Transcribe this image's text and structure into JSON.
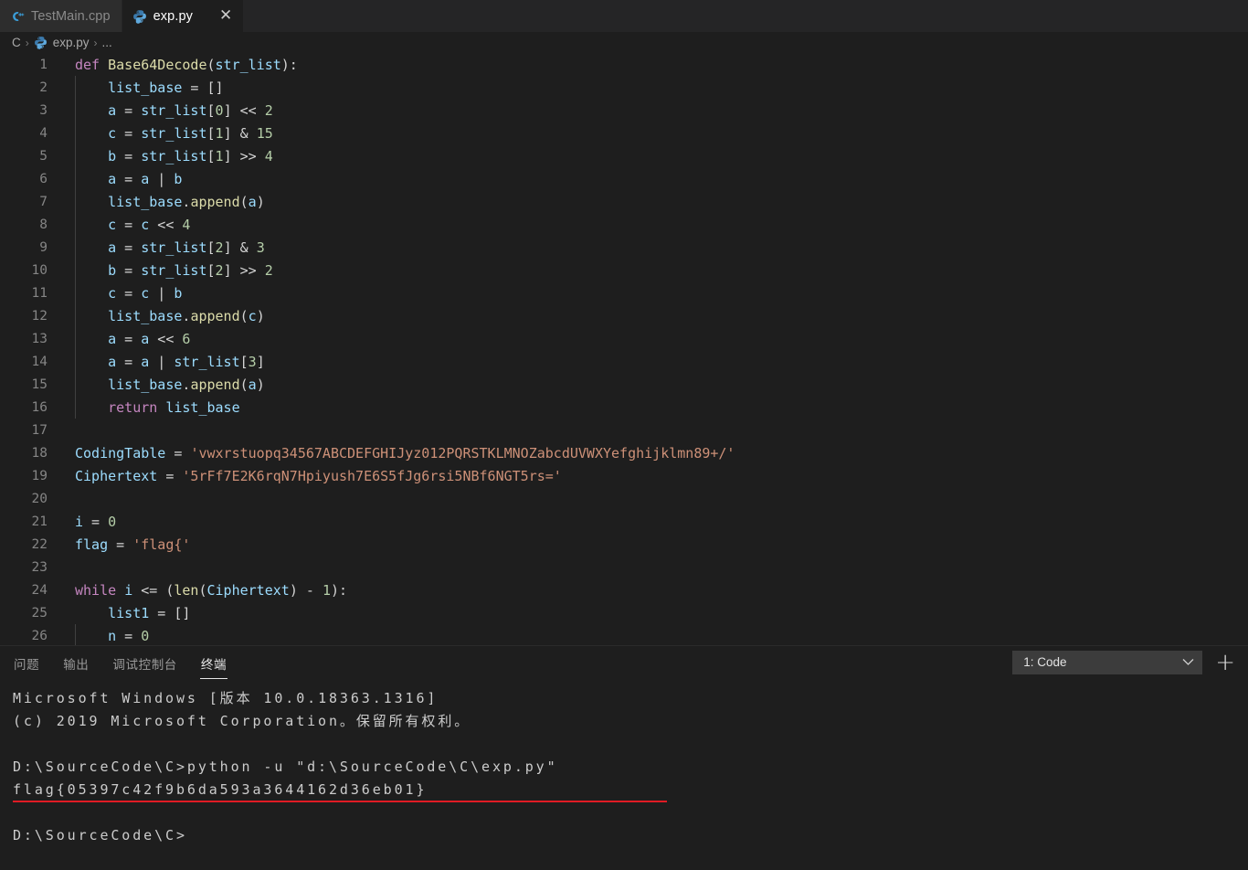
{
  "tabs": [
    {
      "label": "TestMain.cpp",
      "icon": "cpp-file-icon",
      "active": false,
      "closable": false
    },
    {
      "label": "exp.py",
      "icon": "python-file-icon",
      "active": true,
      "closable": true,
      "close_label": "✕"
    }
  ],
  "breadcrumb": {
    "root": "C",
    "separator": "›",
    "file": "exp.py",
    "tail": "..."
  },
  "editor": {
    "language": "python",
    "lines": [
      {
        "n": "1",
        "indent": 0,
        "tokens": [
          {
            "t": "def ",
            "c": "t-kw"
          },
          {
            "t": "Base64Decode",
            "c": "t-fn"
          },
          {
            "t": "(",
            "c": "t-punc"
          },
          {
            "t": "str_list",
            "c": "t-var"
          },
          {
            "t": "):",
            "c": "t-punc"
          }
        ]
      },
      {
        "n": "2",
        "indent": 1,
        "tokens": [
          {
            "t": "list_base",
            "c": "t-var"
          },
          {
            "t": " = ",
            "c": "t-op"
          },
          {
            "t": "[]",
            "c": "t-punc"
          }
        ]
      },
      {
        "n": "3",
        "indent": 1,
        "tokens": [
          {
            "t": "a",
            "c": "t-var"
          },
          {
            "t": " = ",
            "c": "t-op"
          },
          {
            "t": "str_list",
            "c": "t-var"
          },
          {
            "t": "[",
            "c": "t-punc"
          },
          {
            "t": "0",
            "c": "t-num"
          },
          {
            "t": "] ",
            "c": "t-punc"
          },
          {
            "t": "<< ",
            "c": "t-op"
          },
          {
            "t": "2",
            "c": "t-num"
          }
        ]
      },
      {
        "n": "4",
        "indent": 1,
        "tokens": [
          {
            "t": "c",
            "c": "t-var"
          },
          {
            "t": " = ",
            "c": "t-op"
          },
          {
            "t": "str_list",
            "c": "t-var"
          },
          {
            "t": "[",
            "c": "t-punc"
          },
          {
            "t": "1",
            "c": "t-num"
          },
          {
            "t": "] ",
            "c": "t-punc"
          },
          {
            "t": "& ",
            "c": "t-op"
          },
          {
            "t": "15",
            "c": "t-num"
          }
        ]
      },
      {
        "n": "5",
        "indent": 1,
        "tokens": [
          {
            "t": "b",
            "c": "t-var"
          },
          {
            "t": " = ",
            "c": "t-op"
          },
          {
            "t": "str_list",
            "c": "t-var"
          },
          {
            "t": "[",
            "c": "t-punc"
          },
          {
            "t": "1",
            "c": "t-num"
          },
          {
            "t": "] ",
            "c": "t-punc"
          },
          {
            "t": ">> ",
            "c": "t-op"
          },
          {
            "t": "4",
            "c": "t-num"
          }
        ]
      },
      {
        "n": "6",
        "indent": 1,
        "tokens": [
          {
            "t": "a",
            "c": "t-var"
          },
          {
            "t": " = ",
            "c": "t-op"
          },
          {
            "t": "a",
            "c": "t-var"
          },
          {
            "t": " | ",
            "c": "t-op"
          },
          {
            "t": "b",
            "c": "t-var"
          }
        ]
      },
      {
        "n": "7",
        "indent": 1,
        "tokens": [
          {
            "t": "list_base",
            "c": "t-var"
          },
          {
            "t": ".",
            "c": "t-punc"
          },
          {
            "t": "append",
            "c": "t-fn"
          },
          {
            "t": "(",
            "c": "t-punc"
          },
          {
            "t": "a",
            "c": "t-var"
          },
          {
            "t": ")",
            "c": "t-punc"
          }
        ]
      },
      {
        "n": "8",
        "indent": 1,
        "tokens": [
          {
            "t": "c",
            "c": "t-var"
          },
          {
            "t": " = ",
            "c": "t-op"
          },
          {
            "t": "c",
            "c": "t-var"
          },
          {
            "t": " << ",
            "c": "t-op"
          },
          {
            "t": "4",
            "c": "t-num"
          }
        ]
      },
      {
        "n": "9",
        "indent": 1,
        "tokens": [
          {
            "t": "a",
            "c": "t-var"
          },
          {
            "t": " = ",
            "c": "t-op"
          },
          {
            "t": "str_list",
            "c": "t-var"
          },
          {
            "t": "[",
            "c": "t-punc"
          },
          {
            "t": "2",
            "c": "t-num"
          },
          {
            "t": "] ",
            "c": "t-punc"
          },
          {
            "t": "& ",
            "c": "t-op"
          },
          {
            "t": "3",
            "c": "t-num"
          }
        ]
      },
      {
        "n": "10",
        "indent": 1,
        "tokens": [
          {
            "t": "b",
            "c": "t-var"
          },
          {
            "t": " = ",
            "c": "t-op"
          },
          {
            "t": "str_list",
            "c": "t-var"
          },
          {
            "t": "[",
            "c": "t-punc"
          },
          {
            "t": "2",
            "c": "t-num"
          },
          {
            "t": "] ",
            "c": "t-punc"
          },
          {
            "t": ">> ",
            "c": "t-op"
          },
          {
            "t": "2",
            "c": "t-num"
          }
        ]
      },
      {
        "n": "11",
        "indent": 1,
        "tokens": [
          {
            "t": "c",
            "c": "t-var"
          },
          {
            "t": " = ",
            "c": "t-op"
          },
          {
            "t": "c",
            "c": "t-var"
          },
          {
            "t": " | ",
            "c": "t-op"
          },
          {
            "t": "b",
            "c": "t-var"
          }
        ]
      },
      {
        "n": "12",
        "indent": 1,
        "tokens": [
          {
            "t": "list_base",
            "c": "t-var"
          },
          {
            "t": ".",
            "c": "t-punc"
          },
          {
            "t": "append",
            "c": "t-fn"
          },
          {
            "t": "(",
            "c": "t-punc"
          },
          {
            "t": "c",
            "c": "t-var"
          },
          {
            "t": ")",
            "c": "t-punc"
          }
        ]
      },
      {
        "n": "13",
        "indent": 1,
        "tokens": [
          {
            "t": "a",
            "c": "t-var"
          },
          {
            "t": " = ",
            "c": "t-op"
          },
          {
            "t": "a",
            "c": "t-var"
          },
          {
            "t": " << ",
            "c": "t-op"
          },
          {
            "t": "6",
            "c": "t-num"
          }
        ]
      },
      {
        "n": "14",
        "indent": 1,
        "tokens": [
          {
            "t": "a",
            "c": "t-var"
          },
          {
            "t": " = ",
            "c": "t-op"
          },
          {
            "t": "a",
            "c": "t-var"
          },
          {
            "t": " | ",
            "c": "t-op"
          },
          {
            "t": "str_list",
            "c": "t-var"
          },
          {
            "t": "[",
            "c": "t-punc"
          },
          {
            "t": "3",
            "c": "t-num"
          },
          {
            "t": "]",
            "c": "t-punc"
          }
        ]
      },
      {
        "n": "15",
        "indent": 1,
        "tokens": [
          {
            "t": "list_base",
            "c": "t-var"
          },
          {
            "t": ".",
            "c": "t-punc"
          },
          {
            "t": "append",
            "c": "t-fn"
          },
          {
            "t": "(",
            "c": "t-punc"
          },
          {
            "t": "a",
            "c": "t-var"
          },
          {
            "t": ")",
            "c": "t-punc"
          }
        ]
      },
      {
        "n": "16",
        "indent": 1,
        "tokens": [
          {
            "t": "return ",
            "c": "t-kw"
          },
          {
            "t": "list_base",
            "c": "t-var"
          }
        ]
      },
      {
        "n": "17",
        "indent": 0,
        "tokens": []
      },
      {
        "n": "18",
        "indent": 0,
        "tokens": [
          {
            "t": "CodingTable",
            "c": "t-var"
          },
          {
            "t": " = ",
            "c": "t-op"
          },
          {
            "t": "'vwxrstuopq34567ABCDEFGHIJyz012PQRSTKLMNOZabcdUVWXYefghijklmn89+/'",
            "c": "t-str"
          }
        ]
      },
      {
        "n": "19",
        "indent": 0,
        "tokens": [
          {
            "t": "Ciphertext",
            "c": "t-var"
          },
          {
            "t": " = ",
            "c": "t-op"
          },
          {
            "t": "'5rFf7E2K6rqN7Hpiyush7E6S5fJg6rsi5NBf6NGT5rs='",
            "c": "t-str"
          }
        ]
      },
      {
        "n": "20",
        "indent": 0,
        "tokens": []
      },
      {
        "n": "21",
        "indent": 0,
        "tokens": [
          {
            "t": "i",
            "c": "t-var"
          },
          {
            "t": " = ",
            "c": "t-op"
          },
          {
            "t": "0",
            "c": "t-num"
          }
        ]
      },
      {
        "n": "22",
        "indent": 0,
        "tokens": [
          {
            "t": "flag",
            "c": "t-var"
          },
          {
            "t": " = ",
            "c": "t-op"
          },
          {
            "t": "'flag{'",
            "c": "t-str"
          }
        ]
      },
      {
        "n": "23",
        "indent": 0,
        "tokens": []
      },
      {
        "n": "24",
        "indent": 0,
        "tokens": [
          {
            "t": "while ",
            "c": "t-kw"
          },
          {
            "t": "i",
            "c": "t-var"
          },
          {
            "t": " <= ",
            "c": "t-op"
          },
          {
            "t": "(",
            "c": "t-punc"
          },
          {
            "t": "len",
            "c": "t-builtin"
          },
          {
            "t": "(",
            "c": "t-punc"
          },
          {
            "t": "Ciphertext",
            "c": "t-var"
          },
          {
            "t": ") ",
            "c": "t-punc"
          },
          {
            "t": "- ",
            "c": "t-op"
          },
          {
            "t": "1",
            "c": "t-num"
          },
          {
            "t": "):",
            "c": "t-punc"
          }
        ]
      },
      {
        "n": "25",
        "indent": 1,
        "tokens": [
          {
            "t": "list1",
            "c": "t-var"
          },
          {
            "t": " = ",
            "c": "t-op"
          },
          {
            "t": "[]",
            "c": "t-punc"
          }
        ]
      },
      {
        "n": "26",
        "indent": 1,
        "tokens": [
          {
            "t": "n",
            "c": "t-var"
          },
          {
            "t": " = ",
            "c": "t-op"
          },
          {
            "t": "0",
            "c": "t-num"
          }
        ]
      }
    ]
  },
  "panel": {
    "tabs": [
      {
        "label": "问题",
        "active": false
      },
      {
        "label": "输出",
        "active": false
      },
      {
        "label": "调试控制台",
        "active": false
      },
      {
        "label": "终端",
        "active": true
      }
    ],
    "terminal_select": {
      "value": "1: Code",
      "chevron": "⌄"
    },
    "new_terminal_label": "+"
  },
  "terminal": {
    "lines": [
      {
        "text": "Microsoft Windows [版本 10.0.18363.1316]"
      },
      {
        "text": "(c) 2019 Microsoft Corporation。保留所有权利。"
      },
      {
        "text": ""
      },
      {
        "text": "D:\\SourceCode\\C>python -u \"d:\\SourceCode\\C\\exp.py\""
      },
      {
        "text": "flag{05397c42f9b6da593a3644162d36eb01}",
        "highlighted": true
      },
      {
        "text": ""
      },
      {
        "text": "D:\\SourceCode\\C>"
      }
    ],
    "annotation_color": "#e01b24"
  },
  "theme": {
    "editor_bg": "#1e1e1e",
    "tab_inactive_bg": "#2d2d2d",
    "tabbar_bg": "#252526",
    "keyword": "#c586c0",
    "function": "#dcdcaa",
    "variable": "#9cdcfe",
    "string": "#ce9178",
    "number": "#b5cea8",
    "linenumber": "#858585"
  }
}
